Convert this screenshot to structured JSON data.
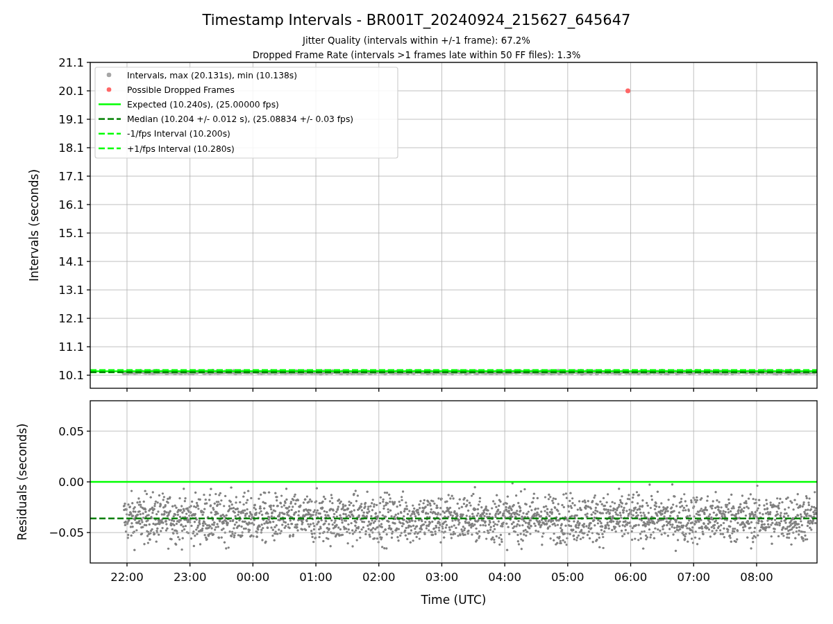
{
  "figure": {
    "title": "Timestamp Intervals - BR001T_20240924_215627_645647",
    "subtitle_lines": [
      "Jitter Quality (intervals within +/-1 frame): 67.2%",
      "Dropped Frame Rate (intervals >1 frames late within 50 FF files): 1.3%"
    ]
  },
  "intervals_plot": {
    "legend": [
      {
        "label": "Intervals, max (20.131s), min (10.138s)",
        "kind": "marker",
        "color": "#a6a6a6"
      },
      {
        "label": "Possible Dropped Frames",
        "kind": "marker",
        "color": "#ff6666"
      },
      {
        "label": "Expected (10.240s), (25.00000 fps)",
        "kind": "solid",
        "color": "#00ff00"
      },
      {
        "label": "Median (10.204 +/- 0.012 s), (25.08834 +/- 0.03 fps)",
        "kind": "dashed",
        "color": "#008000"
      },
      {
        "label": "-1/fps Interval (10.200s)",
        "kind": "dashed",
        "color": "#00ff00"
      },
      {
        "label": "+1/fps Interval (10.280s)",
        "kind": "dashed",
        "color": "#00ff00"
      }
    ],
    "chart_data": {
      "type": "scatter",
      "ylabel": "Intervals (seconds)",
      "ylim": [
        9.64,
        21.1
      ],
      "grid": true,
      "categories": [
        null,
        null,
        null,
        null,
        null,
        null,
        null,
        null,
        null,
        null,
        null
      ],
      "yticks": [
        10.1,
        11.1,
        12.1,
        13.1,
        14.1,
        15.1,
        16.1,
        17.1,
        18.1,
        19.1,
        20.1,
        21.1
      ],
      "series": [
        {
          "color": "#ff6666",
          "values": [
            null,
            null,
            null,
            null,
            null,
            null,
            null,
            null,
            20.1,
            null,
            null
          ]
        }
      ],
      "ref_lines": [
        {
          "axis": "y",
          "value": 10.24,
          "color": "#00ff00"
        },
        {
          "axis": "y",
          "value": 10.204,
          "color": "#008000"
        },
        {
          "axis": "y",
          "value": 10.2,
          "color": "#00ff00"
        },
        {
          "axis": "y",
          "value": 10.28,
          "color": "#00ff00"
        }
      ]
    }
  },
  "residuals_plot": {
    "chart_data": {
      "type": "scatter",
      "xlabel": "Time (UTC)",
      "ylabel": "Residuals (seconds)",
      "ylim": [
        -0.08,
        0.08
      ],
      "grid": true,
      "categories": [
        "22:00",
        "23:00",
        "00:00",
        "01:00",
        "02:00",
        "03:00",
        "04:00",
        "05:00",
        "06:00",
        "07:00",
        "08:00"
      ],
      "yticks": [
        {
          "value": 0.05,
          "label": "0.05"
        },
        {
          "value": 0,
          "label": "0.00"
        },
        {
          "value": -0.05,
          "label": "−0.05"
        }
      ],
      "ref_lines": [
        {
          "axis": "y",
          "value": 0,
          "color": "#00ff00"
        },
        {
          "axis": "y",
          "value": -0.036,
          "color": "#008000"
        }
      ]
    }
  }
}
